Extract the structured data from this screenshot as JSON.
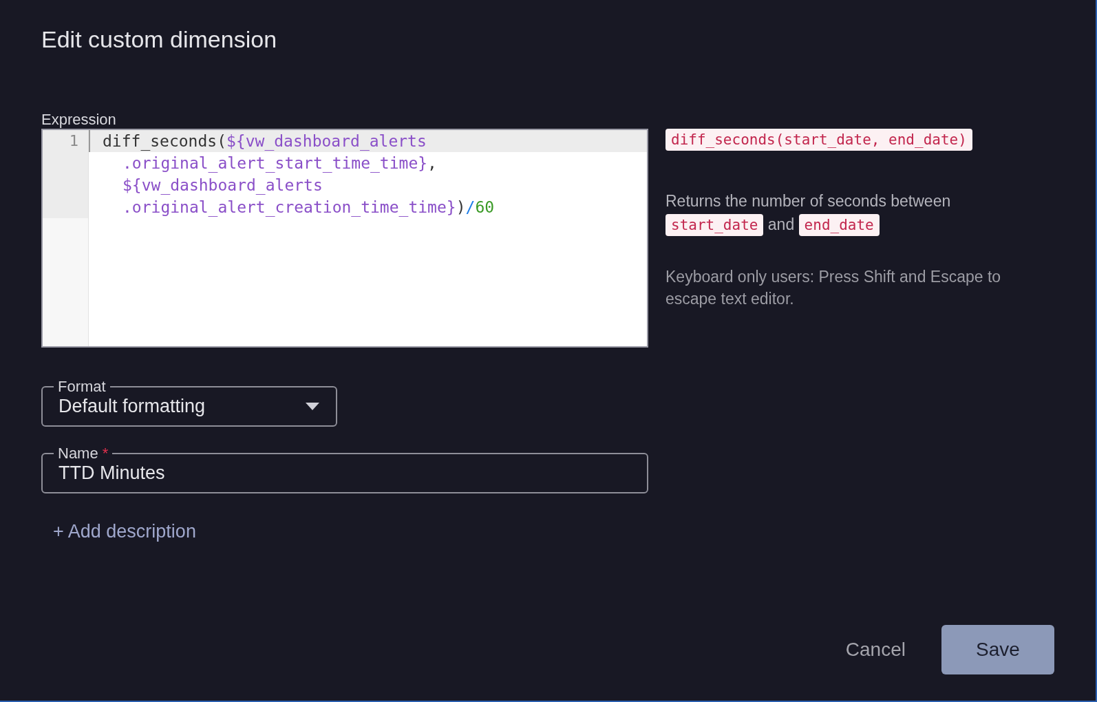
{
  "dialog": {
    "title": "Edit custom dimension"
  },
  "expression": {
    "label": "Expression",
    "lines": [
      {
        "number": "1",
        "active": true,
        "rows": [
          {
            "tokens": [
              {
                "kind": "plain",
                "text": "diff_seconds("
              },
              {
                "kind": "variable",
                "text": "${vw_dashboard_alerts"
              }
            ]
          },
          {
            "tokens": [
              {
                "kind": "variable",
                "text": ".original_alert_start_time_time}"
              },
              {
                "kind": "plain",
                "text": ","
              }
            ]
          },
          {
            "tokens": [
              {
                "kind": "variable",
                "text": "${vw_dashboard_alerts"
              }
            ]
          },
          {
            "tokens": [
              {
                "kind": "variable",
                "text": ".original_alert_creation_time_time}"
              },
              {
                "kind": "plain",
                "text": ")"
              },
              {
                "kind": "operator",
                "text": "/"
              },
              {
                "kind": "number",
                "text": "60"
              }
            ]
          }
        ]
      }
    ]
  },
  "help": {
    "signature": "diff_seconds(start_date, end_date)",
    "description": [
      {
        "kind": "text",
        "text": "Returns the number of seconds between"
      },
      {
        "kind": "code",
        "text": "start_date"
      },
      {
        "kind": "text",
        "text": "and"
      },
      {
        "kind": "code",
        "text": "end_date"
      }
    ],
    "note": "Keyboard only users: Press Shift and Escape to escape text editor."
  },
  "format": {
    "label": "Format",
    "value": "Default formatting"
  },
  "name": {
    "label": "Name",
    "required_mark": "*",
    "value": "TTD Minutes"
  },
  "add_description": "+ Add description",
  "buttons": [
    {
      "kind": "text",
      "label": "Cancel"
    },
    {
      "kind": "primary",
      "label": "Save"
    }
  ]
}
